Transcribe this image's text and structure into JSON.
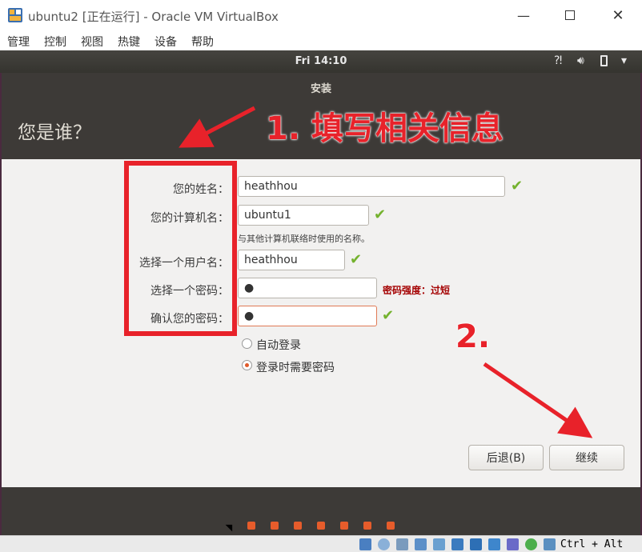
{
  "window": {
    "title": "ubuntu2 [正在运行] - Oracle VM VirtualBox",
    "minimize_icon": "minimize-icon",
    "maximize_icon": "maximize-icon",
    "close_icon": "close-icon"
  },
  "menu": [
    "管理",
    "控制",
    "视图",
    "热键",
    "设备",
    "帮助"
  ],
  "guest_panel": {
    "clock": "Fri 14:10",
    "icons": [
      "accessibility-icon",
      "volume-icon",
      "battery-icon",
      "power-menu-icon"
    ]
  },
  "installer": {
    "title": "安装",
    "heading": "您是谁？",
    "fields": [
      {
        "label": "您的姓名：",
        "value": "heathhou",
        "valid": true
      },
      {
        "label": "您的计算机名：",
        "value": "ubuntu1",
        "valid": true,
        "hint": "与其他计算机联络时使用的名称。"
      },
      {
        "label": "选择一个用户名：",
        "value": "heathhou",
        "valid": true
      },
      {
        "label": "选择一个密码：",
        "value": "●",
        "strength": "密码强度：过短"
      },
      {
        "label": "确认您的密码：",
        "value": "●",
        "valid": true
      }
    ],
    "login_options": [
      {
        "label": "自动登录",
        "selected": false
      },
      {
        "label": "登录时需要密码",
        "selected": true
      }
    ],
    "back_button": "后退(B)",
    "continue_button": "继续",
    "progress_dots": 7
  },
  "annotations": {
    "step1": "1. 填写相关信息",
    "step2": "2.",
    "color": "#e8222a"
  },
  "statusbar": {
    "host_key": "Ctrl + Alt"
  },
  "colors": {
    "accent": "#e05a2a",
    "installer_header": "#3d3a37",
    "valid_check": "#74b22e",
    "warning_text": "#a40000"
  }
}
